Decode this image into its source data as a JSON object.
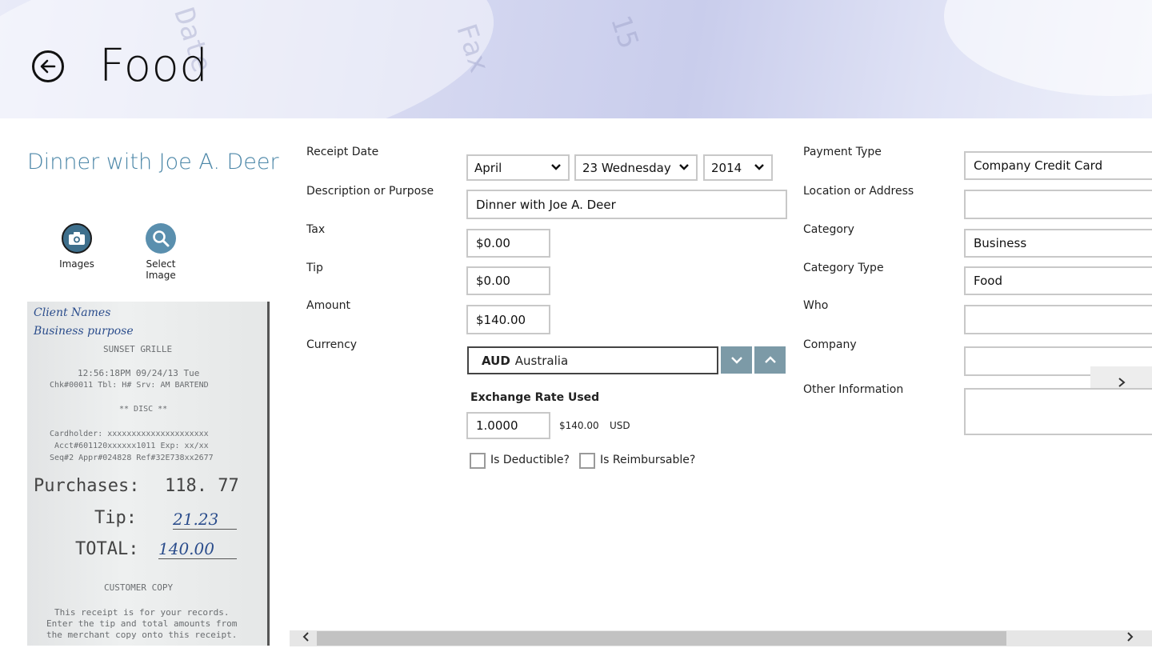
{
  "header": {
    "title": "Food"
  },
  "receipt": {
    "title": "Dinner with Joe A. Deer",
    "images_label": "Images",
    "select_image_label_1": "Select",
    "select_image_label_2": "Image",
    "image_lines": {
      "hand1": "Client Names",
      "hand2": "Business purpose",
      "l1": "SUNSET GRILLE",
      "l2": "12:56:18PM 09/24/13 Tue",
      "l3": "Chk#00011 Tbl: H# Srv: AM BARTEND",
      "l4": "** DISC **",
      "l5": "Cardholder: xxxxxxxxxxxxxxxxxxxxx",
      "l6": "Acct#601120xxxxxx1011 Exp: xx/xx",
      "l7": "Seq#2 Appr#024828 Ref#32E738xx2677",
      "purch_label": "Purchases:",
      "purch_val": "118. 77",
      "tip_label": "Tip:",
      "tip_val": "21.23",
      "total_label": "TOTAL:",
      "total_val": "140.00",
      "l8": "CUSTOMER COPY",
      "l9": "This receipt is for your records.",
      "l10": "Enter the tip and total amounts from",
      "l11": "the merchant copy onto this receipt."
    }
  },
  "form": {
    "receipt_date_label": "Receipt Date",
    "month": "April",
    "day": "23 Wednesday",
    "year": "2014",
    "description_label": "Description or Purpose",
    "description_value": "Dinner with Joe A. Deer",
    "tax_label": "Tax",
    "tax_value": "$0.00",
    "tip_label": "Tip",
    "tip_value": "$0.00",
    "amount_label": "Amount",
    "amount_value": "$140.00",
    "currency_label": "Currency",
    "currency_code": "AUD",
    "currency_name": "Australia",
    "exchange_label": "Exchange Rate Used",
    "exchange_value": "1.0000",
    "converted_amount": "$140.00",
    "converted_currency": "USD",
    "deductible_label": "Is Deductible?",
    "reimbursable_label": "Is Reimbursable?"
  },
  "right": {
    "payment_type_label": "Payment Type",
    "payment_type_value": "Company Credit Card",
    "location_label": "Location or Address",
    "location_value": "",
    "category_label": "Category",
    "category_value": "Business",
    "category_type_label": "Category Type",
    "category_type_value": "Food",
    "who_label": "Who",
    "who_value": "",
    "company_label": "Company",
    "company_value": "",
    "other_info_label": "Other Information",
    "other_info_value": ""
  },
  "colors": {
    "accent": "#4c87a8",
    "button": "#7c9aa7"
  }
}
